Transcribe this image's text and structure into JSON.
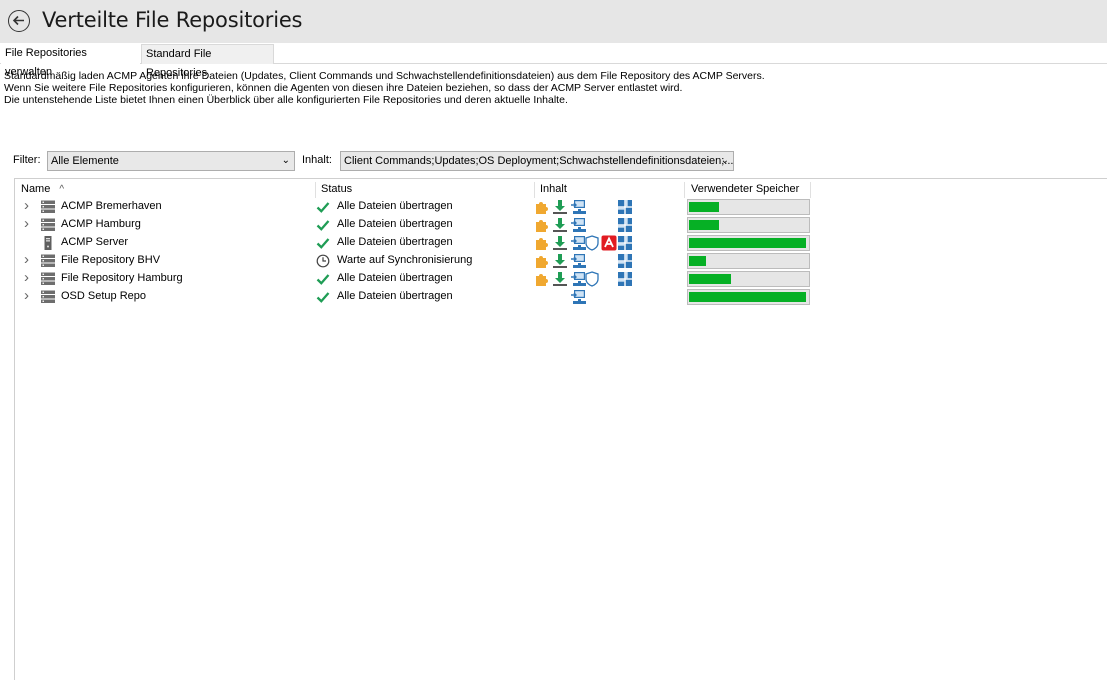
{
  "header": {
    "title": "Verteilte File Repositories"
  },
  "tabs": [
    {
      "label": "File Repositories verwalten",
      "active": true
    },
    {
      "label": "Standard File Repositories",
      "active": false
    }
  ],
  "description": [
    "Standardmäßig laden ACMP Agenten ihre Dateien (Updates,  Client Commands und Schwachstellendefinitionsdateien) aus dem File Repository des ACMP Servers.",
    "Wenn Sie weitere File Repositories konfigurieren, können die Agenten von diesen ihre Dateien beziehen, so dass der ACMP Server entlastet wird.",
    "Die untenstehende Liste bietet Ihnen einen Überblick über alle konfigurierten File Repositories und deren aktuelle Inhalte."
  ],
  "filter": {
    "label": "Filter:",
    "value": "Alle Elemente"
  },
  "content_filter": {
    "label": "Inhalt:",
    "value": "Client Commands;Updates;OS Deployment;Schwachstellendefinitionsdateien;..."
  },
  "columns": {
    "name": "Name",
    "status": "Status",
    "content": "Inhalt",
    "storage": "Verwendeter Speicher"
  },
  "colors": {
    "bar_fill": "#06b025",
    "check": "#1f9d55",
    "accent": "#2e75b6"
  },
  "rows": [
    {
      "name": "ACMP Bremerhaven",
      "status": "Alle Dateien übertragen",
      "status_icon": "check-icon",
      "server_icon": "server-rack-icon",
      "expandable": true,
      "content_icons": [
        "puzzle-icon",
        "download-icon",
        "os-deploy-icon",
        "windows-icon"
      ],
      "storage_fraction": 0.25
    },
    {
      "name": "ACMP Hamburg",
      "status": "Alle Dateien übertragen",
      "status_icon": "check-icon",
      "server_icon": "server-rack-icon",
      "expandable": true,
      "content_icons": [
        "puzzle-icon",
        "download-icon",
        "os-deploy-icon",
        "windows-icon"
      ],
      "storage_fraction": 0.25
    },
    {
      "name": "ACMP Server",
      "status": "Alle Dateien übertragen",
      "status_icon": "check-icon",
      "server_icon": "server-tower-icon",
      "expandable": false,
      "content_icons": [
        "puzzle-icon",
        "download-icon",
        "os-deploy-icon",
        "shield-icon",
        "avira-icon",
        "windows-icon"
      ],
      "storage_fraction": 0.98
    },
    {
      "name": "File Repository BHV",
      "status": "Warte auf Synchronisierung",
      "status_icon": "clock-icon",
      "server_icon": "server-rack-icon",
      "expandable": true,
      "content_icons": [
        "puzzle-icon",
        "download-icon",
        "os-deploy-icon",
        "windows-icon"
      ],
      "storage_fraction": 0.14
    },
    {
      "name": "File Repository Hamburg",
      "status": "Alle Dateien übertragen",
      "status_icon": "check-icon",
      "server_icon": "server-rack-icon",
      "expandable": true,
      "content_icons": [
        "puzzle-icon",
        "download-icon",
        "os-deploy-icon",
        "shield-icon",
        "windows-icon"
      ],
      "storage_fraction": 0.35
    },
    {
      "name": "OSD Setup Repo",
      "status": "Alle Dateien übertragen",
      "status_icon": "check-icon",
      "server_icon": "server-rack-icon",
      "expandable": true,
      "content_icons": [
        "os-deploy-icon"
      ],
      "storage_fraction": 0.98
    }
  ]
}
